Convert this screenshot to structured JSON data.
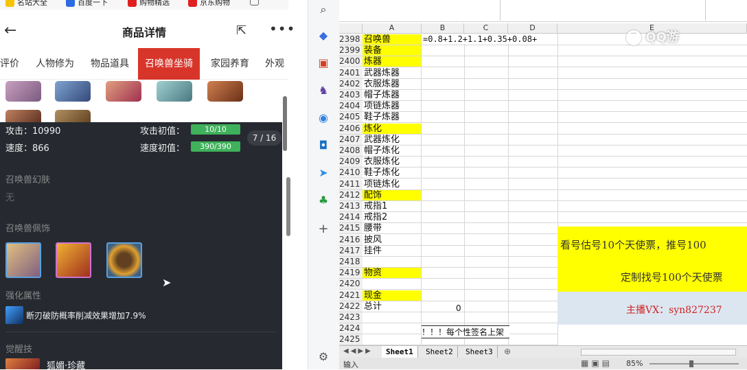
{
  "bookmarks": [
    "名站大全",
    "百度一下",
    "购物精选",
    "京东购物"
  ],
  "nav": {
    "title": "商品详情"
  },
  "tabs": [
    "评价",
    "人物修为",
    "物品道具",
    "召唤兽坐骑",
    "家园养育",
    "外观"
  ],
  "stats": {
    "attack_label": "攻击：",
    "attack_value": "10990",
    "attack_init_label": "攻击初值：",
    "attack_init_value": "10/10",
    "speed_label": "速度：",
    "speed_value": "866",
    "speed_init_label": "速度初值：",
    "speed_init_value": "390/390",
    "pager": "7 / 16"
  },
  "sections": {
    "skin_title": "召唤兽幻肤",
    "skin_value": "无",
    "accessory_title": "召唤兽佩饰",
    "enhance_title": "强化属性",
    "enhance_text": "断刃破防概率削减效果增加7.9%",
    "awaken_title": "觉醒技",
    "awaken_value": "狐媚·珍藏"
  },
  "sheet": {
    "columns": [
      "A",
      "B",
      "C",
      "D",
      "E"
    ],
    "formula": "=0.8+1.2+1.1+0.35+0.08+",
    "rows": [
      {
        "n": "2398",
        "a": "召唤兽",
        "yellow": true
      },
      {
        "n": "2399",
        "a": "装备",
        "yellow": true
      },
      {
        "n": "2400",
        "a": "炼器",
        "yellow": true
      },
      {
        "n": "2401",
        "a": "武器炼器",
        "yellow": false
      },
      {
        "n": "2402",
        "a": "衣服炼器",
        "yellow": false
      },
      {
        "n": "2403",
        "a": "帽子炼器",
        "yellow": false
      },
      {
        "n": "2404",
        "a": "项链炼器",
        "yellow": false
      },
      {
        "n": "2405",
        "a": "鞋子炼器",
        "yellow": false
      },
      {
        "n": "2406",
        "a": "炼化",
        "yellow": true
      },
      {
        "n": "2407",
        "a": "武器炼化",
        "yellow": false
      },
      {
        "n": "2408",
        "a": "帽子炼化",
        "yellow": false
      },
      {
        "n": "2409",
        "a": "衣服炼化",
        "yellow": false
      },
      {
        "n": "2410",
        "a": "鞋子炼化",
        "yellow": false
      },
      {
        "n": "2411",
        "a": "项链炼化",
        "yellow": false
      },
      {
        "n": "2412",
        "a": "配饰",
        "yellow": true
      },
      {
        "n": "2413",
        "a": "戒指1",
        "yellow": false
      },
      {
        "n": "2414",
        "a": "戒指2",
        "yellow": false
      },
      {
        "n": "2415",
        "a": "腰带",
        "yellow": false
      },
      {
        "n": "2416",
        "a": "披风",
        "yellow": false
      },
      {
        "n": "2417",
        "a": "挂件",
        "yellow": false
      },
      {
        "n": "2418",
        "a": "",
        "yellow": false
      },
      {
        "n": "2419",
        "a": "物资",
        "yellow": true
      },
      {
        "n": "2420",
        "a": "",
        "yellow": false
      },
      {
        "n": "2421",
        "a": "现金",
        "yellow": true
      },
      {
        "n": "2422",
        "a": "总计",
        "yellow": false
      },
      {
        "n": "2423",
        "a": "",
        "yellow": false
      },
      {
        "n": "2424",
        "a": "",
        "yellow": false
      },
      {
        "n": "2425",
        "a": "",
        "yellow": false
      }
    ],
    "total_value": "0",
    "row2424_text": "每个性签名上架！！！",
    "ad1": "看号估号10个天使票，推号100",
    "ad2": "定制找号100个天使票",
    "ad3": "主播VX：syn827237",
    "sheet_tabs": [
      "Sheet1",
      "Sheet2",
      "Sheet3"
    ],
    "status_left": "输入",
    "zoom": "85%"
  },
  "watermark": "QQ游"
}
